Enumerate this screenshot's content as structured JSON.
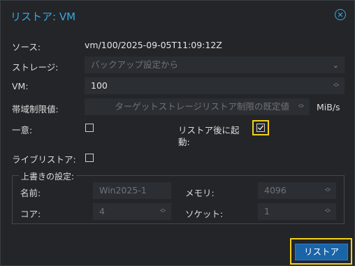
{
  "dialog": {
    "title": "リストア: VM",
    "close_icon": "close-circle-icon"
  },
  "source": {
    "label": "ソース:",
    "value": "vm/100/2025-09-05T11:09:12Z"
  },
  "storage": {
    "label": "ストレージ:",
    "placeholder": "バックアップ設定から"
  },
  "vm": {
    "label": "VM:",
    "value": "100"
  },
  "bandwidth": {
    "label": "帯域制限値:",
    "placeholder": "ターゲットストレージリストア制限の既定値",
    "unit": "MiB/s"
  },
  "unique": {
    "label": "一意:",
    "checked": false
  },
  "start_after_restore": {
    "label_line1": "リストア後に起",
    "label_line2": "動:",
    "checked": true
  },
  "live_restore": {
    "label": "ライブリストア:",
    "checked": false
  },
  "override": {
    "legend": "上書きの設定:",
    "name": {
      "label": "名前:",
      "placeholder": "Win2025-1"
    },
    "memory": {
      "label": "メモリ:",
      "placeholder": "4096"
    },
    "cores": {
      "label": "コア:",
      "placeholder": "4"
    },
    "sockets": {
      "label": "ソケット:",
      "placeholder": "1"
    }
  },
  "buttons": {
    "restore": "リストア"
  },
  "colors": {
    "accent": "#38a9e6",
    "button": "#1a64a8",
    "highlight": "#f3d11a"
  }
}
